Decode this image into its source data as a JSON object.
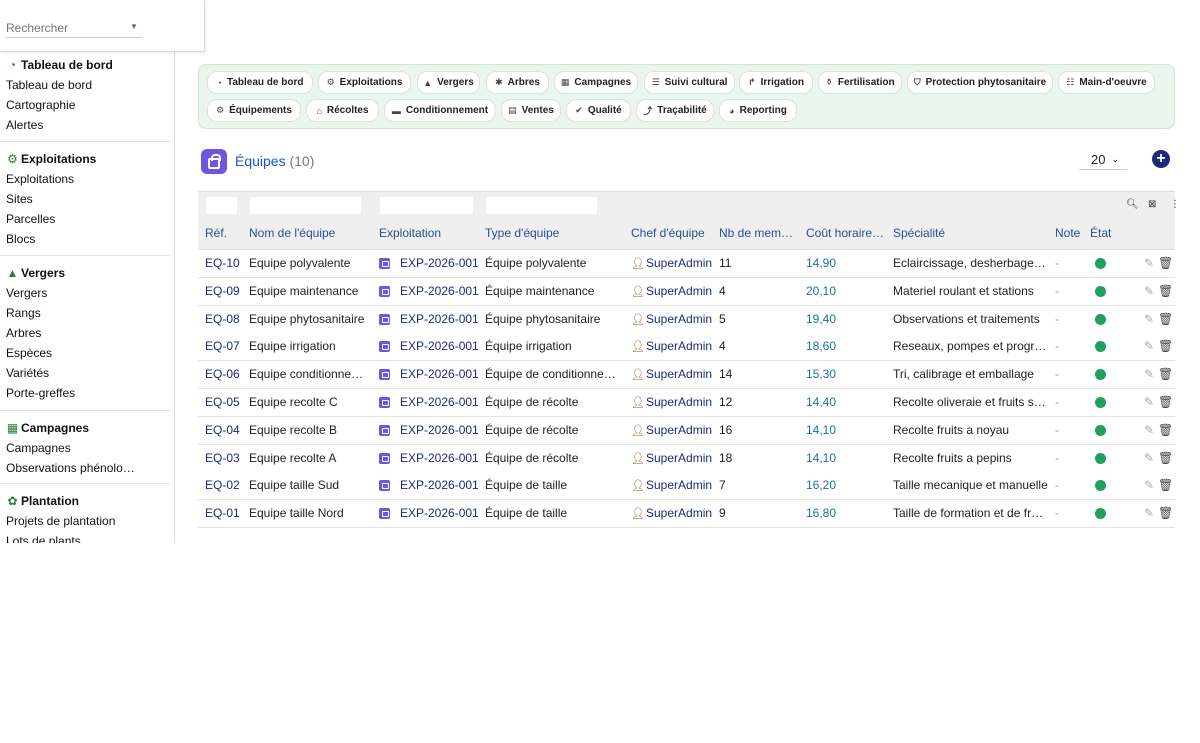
{
  "search": {
    "placeholder": "Rechercher"
  },
  "sidebar": {
    "sections": [
      {
        "title": "Tableau de bord",
        "icon": "dashboard-gauge-icon",
        "items": [
          "Tableau de bord",
          "Cartographie",
          "Alertes"
        ]
      },
      {
        "title": "Exploitations",
        "icon": "tractor-icon",
        "items": [
          "Exploitations",
          "Sites",
          "Parcelles",
          "Blocs"
        ]
      },
      {
        "title": "Vergers",
        "icon": "tree-icon",
        "items": [
          "Vergers",
          "Rangs",
          "Arbres",
          "Espèces",
          "Variétés",
          "Porte-greffes"
        ]
      },
      {
        "title": "Campagnes",
        "icon": "calendar-icon",
        "items": [
          "Campagnes",
          "Observations phénologiques"
        ]
      },
      {
        "title": "Plantation",
        "icon": "seedling-icon",
        "items": [
          "Projets de plantation",
          "Lots de plants"
        ]
      }
    ]
  },
  "modules": {
    "row1": [
      {
        "label": "Tableau de bord",
        "icon": "dashboard-gauge-icon"
      },
      {
        "label": "Exploitations",
        "icon": "tractor-icon"
      },
      {
        "label": "Vergers",
        "icon": "tree-icon"
      },
      {
        "label": "Arbres",
        "icon": "branch-icon"
      },
      {
        "label": "Campagnes",
        "icon": "calendar-icon"
      },
      {
        "label": "Suivi cultural",
        "icon": "list-icon"
      },
      {
        "label": "Irrigation",
        "icon": "faucet-icon"
      },
      {
        "label": "Fertilisation",
        "icon": "flask-icon"
      },
      {
        "label": "Protection phytosanitaire",
        "icon": "shield-icon"
      },
      {
        "label": "Main-d'oeuvre",
        "icon": "users-icon"
      }
    ],
    "row2": [
      {
        "label": "Équipements",
        "icon": "tractor-icon"
      },
      {
        "label": "Récoltes",
        "icon": "basket-icon"
      },
      {
        "label": "Conditionnement",
        "icon": "box-icon"
      },
      {
        "label": "Ventes",
        "icon": "receipt-icon"
      },
      {
        "label": "Qualité",
        "icon": "check-icon"
      },
      {
        "label": "Traçabilité",
        "icon": "route-icon"
      },
      {
        "label": "Reporting",
        "icon": "pie-chart-icon"
      }
    ]
  },
  "page": {
    "title": "Équipes",
    "count": "(10)",
    "per_page": "20"
  },
  "table": {
    "columns": [
      "Réf.",
      "Nom de l'équipe",
      "Exploitation",
      "Type d'équipe",
      "Chef d'équipe",
      "Nb de membres",
      "Coût horaire moyen",
      "Spécialité",
      "Note",
      "État"
    ],
    "rows": [
      {
        "ref": "EQ-10",
        "name": "Equipe polyvalente",
        "exploitation": "EXP-2026-001",
        "type": "Équipe polyvalente",
        "chef": "SuperAdmin",
        "members": "11",
        "cost": "14,90",
        "specialty": "Eclaircissage, desherbage, divers",
        "note": "-"
      },
      {
        "ref": "EQ-09",
        "name": "Equipe maintenance",
        "exploitation": "EXP-2026-001",
        "type": "Équipe maintenance",
        "chef": "SuperAdmin",
        "members": "4",
        "cost": "20,10",
        "specialty": "Materiel roulant et stations",
        "note": "-"
      },
      {
        "ref": "EQ-08",
        "name": "Equipe phytosanitaire",
        "exploitation": "EXP-2026-001",
        "type": "Équipe phytosanitaire",
        "chef": "SuperAdmin",
        "members": "5",
        "cost": "19,40",
        "specialty": "Observations et traitements",
        "note": "-"
      },
      {
        "ref": "EQ-07",
        "name": "Equipe irrigation",
        "exploitation": "EXP-2026-001",
        "type": "Équipe irrigation",
        "chef": "SuperAdmin",
        "members": "4",
        "cost": "18,60",
        "specialty": "Reseaux, pompes et programmation",
        "note": "-"
      },
      {
        "ref": "EQ-06",
        "name": "Equipe conditionnement",
        "exploitation": "EXP-2026-001",
        "type": "Équipe de conditionnement",
        "chef": "SuperAdmin",
        "members": "14",
        "cost": "15,30",
        "specialty": "Tri, calibrage et emballage",
        "note": "-"
      },
      {
        "ref": "EQ-05",
        "name": "Equipe recolte C",
        "exploitation": "EXP-2026-001",
        "type": "Équipe de récolte",
        "chef": "SuperAdmin",
        "members": "12",
        "cost": "14,40",
        "specialty": "Recolte oliveraie et fruits secs",
        "note": "-"
      },
      {
        "ref": "EQ-04",
        "name": "Equipe recolte B",
        "exploitation": "EXP-2026-001",
        "type": "Équipe de récolte",
        "chef": "SuperAdmin",
        "members": "16",
        "cost": "14,10",
        "specialty": "Recolte fruits a noyau",
        "note": "-"
      },
      {
        "ref": "EQ-03",
        "name": "Equipe recolte A",
        "exploitation": "EXP-2026-001",
        "type": "Équipe de récolte",
        "chef": "SuperAdmin",
        "members": "18",
        "cost": "14,10",
        "specialty": "Recolte fruits a pepins",
        "note": "-"
      },
      {
        "ref": "EQ-02",
        "name": "Equipe taille Sud",
        "exploitation": "EXP-2026-001",
        "type": "Équipe de taille",
        "chef": "SuperAdmin",
        "members": "7",
        "cost": "16,20",
        "specialty": "Taille mecanique et manuelle",
        "note": "-"
      },
      {
        "ref": "EQ-01",
        "name": "Equipe taille Nord",
        "exploitation": "EXP-2026-001",
        "type": "Équipe de taille",
        "chef": "SuperAdmin",
        "members": "9",
        "cost": "16,80",
        "specialty": "Taille de formation et de fructification",
        "note": "-"
      }
    ]
  },
  "colors": {
    "accent": "#1b2a7a",
    "link": "#2a4f94",
    "status_active": "#20a05c",
    "module_bg": "#eaf5ee",
    "brand_purple": "#6f55e0"
  }
}
